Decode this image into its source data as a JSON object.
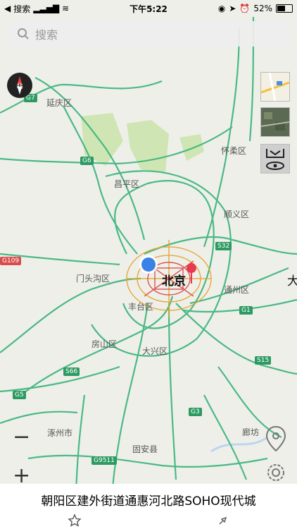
{
  "status": {
    "carrier": "搜索",
    "time": "下午5:22",
    "battery": "52%"
  },
  "search": {
    "placeholder": "搜索"
  },
  "map": {
    "labels": {
      "yanqing": "延庆区",
      "huairou": "怀柔区",
      "changping": "昌平区",
      "shunyi": "顺义区",
      "mentougou": "门头沟区",
      "beijing": "北京",
      "fengtai": "丰台区",
      "tongzhou": "通州区",
      "fangshan": "房山区",
      "daxing": "大兴区",
      "zhuozhou": "涿州市",
      "guan": "固安县",
      "langfang": "廊坊",
      "da": "大"
    },
    "shields": {
      "g7": "G7",
      "g6": "G6",
      "s32": "S32",
      "g109": "G109",
      "g1": "G1",
      "s15": "S15",
      "s66": "S66",
      "g5": "G5",
      "g3": "G3",
      "g9511": "G9511"
    }
  },
  "bottom": {
    "address": "朝阳区建外街道通惠河北路SOHO现代城"
  }
}
